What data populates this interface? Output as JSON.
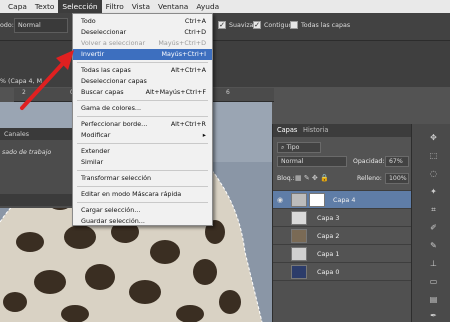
{
  "menubar": {
    "items": [
      "Capa",
      "Texto",
      "Selección",
      "Filtro",
      "Vista",
      "Ventana",
      "Ayuda"
    ],
    "active": "Selección"
  },
  "options": {
    "mode_label": "odo:",
    "mode_value": "Normal",
    "smooth_label": "Suavizar",
    "contiguous_label": "Contiguo",
    "all_layers_label": "Todas las capas"
  },
  "document": {
    "tab_title": "% (Capa 4, M",
    "ruler_marks": [
      "2",
      "0",
      "2",
      "4",
      "6"
    ]
  },
  "left_panel": {
    "tab": "Canales",
    "text": "sado de trabajo"
  },
  "selection_menu": {
    "items": [
      {
        "label": "Todo",
        "shortcut": "Ctrl+A",
        "disabled": false,
        "highlighted": false
      },
      {
        "label": "Deseleccionar",
        "shortcut": "Ctrl+D",
        "disabled": false,
        "highlighted": false
      },
      {
        "label": "Volver a seleccionar",
        "shortcut": "Mayús+Ctrl+D",
        "disabled": true,
        "highlighted": false
      },
      {
        "label": "Invertir",
        "shortcut": "Mayús+Ctrl+I",
        "disabled": false,
        "highlighted": true
      },
      {
        "label": "Todas las capas",
        "shortcut": "Alt+Ctrl+A",
        "disabled": false,
        "highlighted": false
      },
      {
        "label": "Deseleccionar capas",
        "shortcut": "",
        "disabled": false,
        "highlighted": false
      },
      {
        "label": "Buscar capas",
        "shortcut": "Alt+Mayús+Ctrl+F",
        "disabled": false,
        "highlighted": false
      },
      {
        "label": "Gama de colores...",
        "shortcut": "",
        "disabled": false,
        "highlighted": false
      },
      {
        "label": "Perfeccionar borde...",
        "shortcut": "Alt+Ctrl+R",
        "disabled": false,
        "highlighted": false
      },
      {
        "label": "Modificar",
        "shortcut": "",
        "submenu": true,
        "disabled": false,
        "highlighted": false
      },
      {
        "label": "Extender",
        "shortcut": "",
        "disabled": false,
        "highlighted": false
      },
      {
        "label": "Similar",
        "shortcut": "",
        "disabled": false,
        "highlighted": false
      },
      {
        "label": "Transformar selección",
        "shortcut": "",
        "disabled": false,
        "highlighted": false
      },
      {
        "label": "Editar en modo Máscara rápida",
        "shortcut": "",
        "disabled": false,
        "highlighted": false
      },
      {
        "label": "Cargar selección...",
        "shortcut": "",
        "disabled": false,
        "highlighted": false
      },
      {
        "label": "Guardar selección...",
        "shortcut": "",
        "disabled": false,
        "highlighted": false
      }
    ]
  },
  "layers_panel": {
    "tabs": [
      "Capas",
      "Historia"
    ],
    "filter_label": "Tipo",
    "blend_mode": "Normal",
    "opacity_label": "Opacidad:",
    "opacity_value": "67%",
    "lock_label": "Bloq.:",
    "fill_label": "Relleno:",
    "fill_value": "100%",
    "layers": [
      {
        "name": "Capa 4",
        "selected": true
      },
      {
        "name": "Capa 3",
        "selected": false
      },
      {
        "name": "Capa 2",
        "selected": false
      },
      {
        "name": "Capa 1",
        "selected": false
      },
      {
        "name": "Capa 0",
        "selected": false
      }
    ]
  },
  "colors": {
    "highlight": "#3d6fbf",
    "selected_layer": "#5f7da7",
    "arrow": "#e02020",
    "canvas_sky": "#8a96a6"
  }
}
